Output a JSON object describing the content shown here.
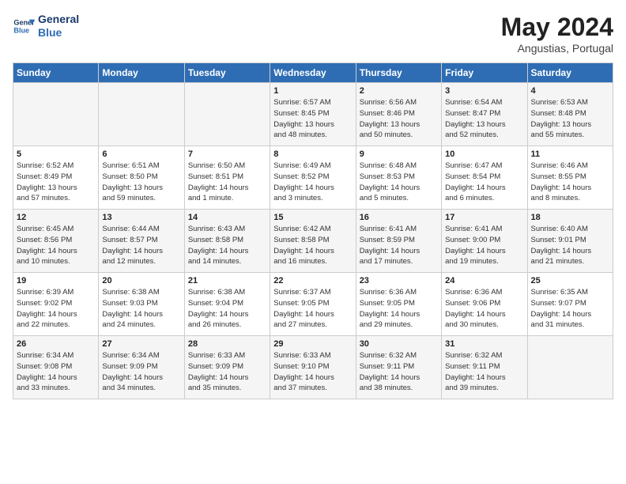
{
  "header": {
    "logo_line1": "General",
    "logo_line2": "Blue",
    "month": "May 2024",
    "location": "Angustias, Portugal"
  },
  "weekdays": [
    "Sunday",
    "Monday",
    "Tuesday",
    "Wednesday",
    "Thursday",
    "Friday",
    "Saturday"
  ],
  "weeks": [
    [
      {
        "day": "",
        "info": ""
      },
      {
        "day": "",
        "info": ""
      },
      {
        "day": "",
        "info": ""
      },
      {
        "day": "1",
        "info": "Sunrise: 6:57 AM\nSunset: 8:45 PM\nDaylight: 13 hours\nand 48 minutes."
      },
      {
        "day": "2",
        "info": "Sunrise: 6:56 AM\nSunset: 8:46 PM\nDaylight: 13 hours\nand 50 minutes."
      },
      {
        "day": "3",
        "info": "Sunrise: 6:54 AM\nSunset: 8:47 PM\nDaylight: 13 hours\nand 52 minutes."
      },
      {
        "day": "4",
        "info": "Sunrise: 6:53 AM\nSunset: 8:48 PM\nDaylight: 13 hours\nand 55 minutes."
      }
    ],
    [
      {
        "day": "5",
        "info": "Sunrise: 6:52 AM\nSunset: 8:49 PM\nDaylight: 13 hours\nand 57 minutes."
      },
      {
        "day": "6",
        "info": "Sunrise: 6:51 AM\nSunset: 8:50 PM\nDaylight: 13 hours\nand 59 minutes."
      },
      {
        "day": "7",
        "info": "Sunrise: 6:50 AM\nSunset: 8:51 PM\nDaylight: 14 hours\nand 1 minute."
      },
      {
        "day": "8",
        "info": "Sunrise: 6:49 AM\nSunset: 8:52 PM\nDaylight: 14 hours\nand 3 minutes."
      },
      {
        "day": "9",
        "info": "Sunrise: 6:48 AM\nSunset: 8:53 PM\nDaylight: 14 hours\nand 5 minutes."
      },
      {
        "day": "10",
        "info": "Sunrise: 6:47 AM\nSunset: 8:54 PM\nDaylight: 14 hours\nand 6 minutes."
      },
      {
        "day": "11",
        "info": "Sunrise: 6:46 AM\nSunset: 8:55 PM\nDaylight: 14 hours\nand 8 minutes."
      }
    ],
    [
      {
        "day": "12",
        "info": "Sunrise: 6:45 AM\nSunset: 8:56 PM\nDaylight: 14 hours\nand 10 minutes."
      },
      {
        "day": "13",
        "info": "Sunrise: 6:44 AM\nSunset: 8:57 PM\nDaylight: 14 hours\nand 12 minutes."
      },
      {
        "day": "14",
        "info": "Sunrise: 6:43 AM\nSunset: 8:58 PM\nDaylight: 14 hours\nand 14 minutes."
      },
      {
        "day": "15",
        "info": "Sunrise: 6:42 AM\nSunset: 8:58 PM\nDaylight: 14 hours\nand 16 minutes."
      },
      {
        "day": "16",
        "info": "Sunrise: 6:41 AM\nSunset: 8:59 PM\nDaylight: 14 hours\nand 17 minutes."
      },
      {
        "day": "17",
        "info": "Sunrise: 6:41 AM\nSunset: 9:00 PM\nDaylight: 14 hours\nand 19 minutes."
      },
      {
        "day": "18",
        "info": "Sunrise: 6:40 AM\nSunset: 9:01 PM\nDaylight: 14 hours\nand 21 minutes."
      }
    ],
    [
      {
        "day": "19",
        "info": "Sunrise: 6:39 AM\nSunset: 9:02 PM\nDaylight: 14 hours\nand 22 minutes."
      },
      {
        "day": "20",
        "info": "Sunrise: 6:38 AM\nSunset: 9:03 PM\nDaylight: 14 hours\nand 24 minutes."
      },
      {
        "day": "21",
        "info": "Sunrise: 6:38 AM\nSunset: 9:04 PM\nDaylight: 14 hours\nand 26 minutes."
      },
      {
        "day": "22",
        "info": "Sunrise: 6:37 AM\nSunset: 9:05 PM\nDaylight: 14 hours\nand 27 minutes."
      },
      {
        "day": "23",
        "info": "Sunrise: 6:36 AM\nSunset: 9:05 PM\nDaylight: 14 hours\nand 29 minutes."
      },
      {
        "day": "24",
        "info": "Sunrise: 6:36 AM\nSunset: 9:06 PM\nDaylight: 14 hours\nand 30 minutes."
      },
      {
        "day": "25",
        "info": "Sunrise: 6:35 AM\nSunset: 9:07 PM\nDaylight: 14 hours\nand 31 minutes."
      }
    ],
    [
      {
        "day": "26",
        "info": "Sunrise: 6:34 AM\nSunset: 9:08 PM\nDaylight: 14 hours\nand 33 minutes."
      },
      {
        "day": "27",
        "info": "Sunrise: 6:34 AM\nSunset: 9:09 PM\nDaylight: 14 hours\nand 34 minutes."
      },
      {
        "day": "28",
        "info": "Sunrise: 6:33 AM\nSunset: 9:09 PM\nDaylight: 14 hours\nand 35 minutes."
      },
      {
        "day": "29",
        "info": "Sunrise: 6:33 AM\nSunset: 9:10 PM\nDaylight: 14 hours\nand 37 minutes."
      },
      {
        "day": "30",
        "info": "Sunrise: 6:32 AM\nSunset: 9:11 PM\nDaylight: 14 hours\nand 38 minutes."
      },
      {
        "day": "31",
        "info": "Sunrise: 6:32 AM\nSunset: 9:11 PM\nDaylight: 14 hours\nand 39 minutes."
      },
      {
        "day": "",
        "info": ""
      }
    ]
  ]
}
